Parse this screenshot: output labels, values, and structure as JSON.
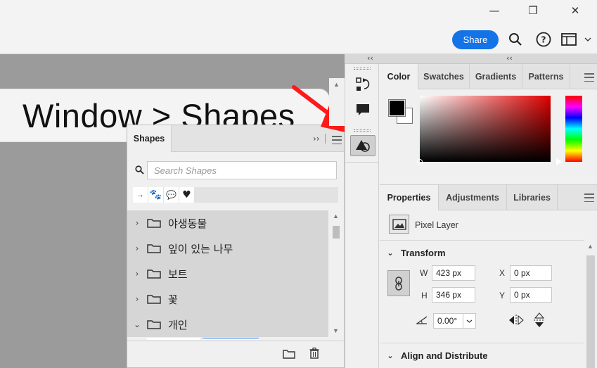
{
  "window": {
    "minimize_glyph": "—",
    "maximize_glyph": "❐",
    "close_glyph": "✕"
  },
  "toolbar": {
    "share_label": "Share",
    "icons": [
      "search-icon",
      "help-icon",
      "workspace-icon",
      "chevron-down-icon"
    ]
  },
  "callout": {
    "text": "Window > Shapes"
  },
  "shapes_panel": {
    "tab_label": "Shapes",
    "search_placeholder": "Search Shapes",
    "presets": [
      "→",
      "🐾",
      "💬",
      "♥"
    ],
    "groups": [
      {
        "label": "야생동물",
        "expanded": false
      },
      {
        "label": "잎이 있는 나무",
        "expanded": false
      },
      {
        "label": "보트",
        "expanded": false
      },
      {
        "label": "꽃",
        "expanded": false
      },
      {
        "label": "개인",
        "expanded": true
      }
    ]
  },
  "dock": {
    "items": [
      "history-icon",
      "comment-icon",
      "shapes-icon"
    ],
    "collapse_glyph": "‹‹"
  },
  "color_panel": {
    "tabs": [
      "Color",
      "Swatches",
      "Gradients",
      "Patterns"
    ],
    "active_tab": "Color",
    "foreground_color": "#000000",
    "background_color": "#ffffff",
    "hue_color": "#e00000"
  },
  "properties_panel": {
    "tabs": [
      "Properties",
      "Adjustments",
      "Libraries"
    ],
    "active_tab": "Properties",
    "layer_type": "Pixel Layer",
    "transform": {
      "title": "Transform",
      "w_label": "W",
      "w_value": "423 px",
      "h_label": "H",
      "h_value": "346 px",
      "x_label": "X",
      "x_value": "0 px",
      "y_label": "Y",
      "y_value": "0 px",
      "angle_value": "0.00°"
    },
    "align_title": "Align and Distribute"
  },
  "colors": {
    "accent": "#1473e6",
    "canvas": "#9b9b9b",
    "arrow": "#ff1a1a"
  }
}
